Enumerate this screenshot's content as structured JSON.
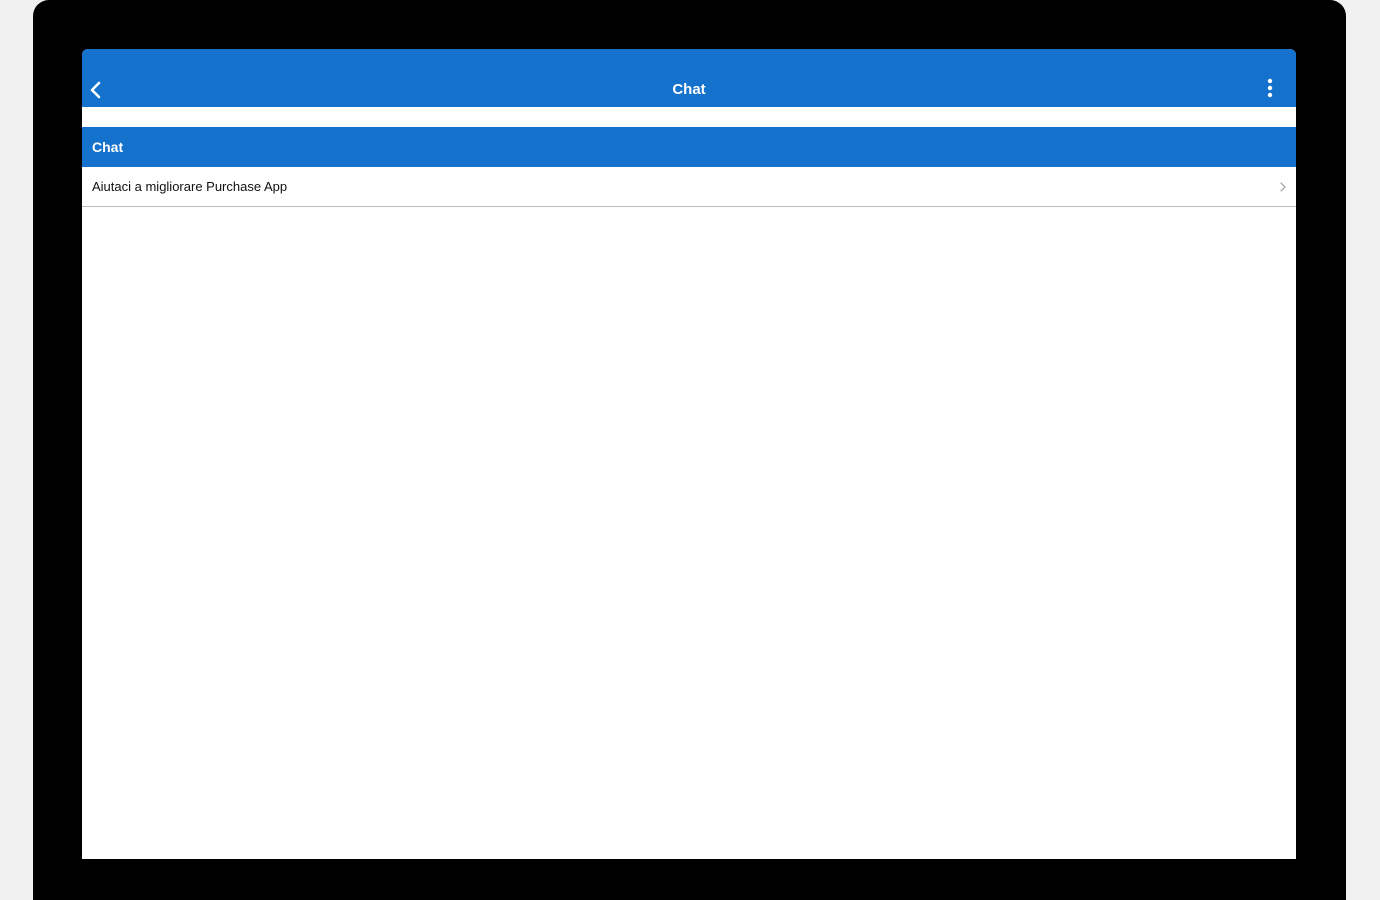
{
  "app_bar": {
    "title": "Chat",
    "back_icon": "chevron-left-icon",
    "menu_icon": "more-vertical-icon"
  },
  "section": {
    "header": "Chat"
  },
  "list": {
    "items": [
      {
        "label": "Aiutaci a migliorare Purchase App",
        "icon": "chevron-right-icon"
      }
    ]
  },
  "colors": {
    "accent": "#1572cc",
    "background": "#ffffff",
    "device_frame": "#000000"
  }
}
